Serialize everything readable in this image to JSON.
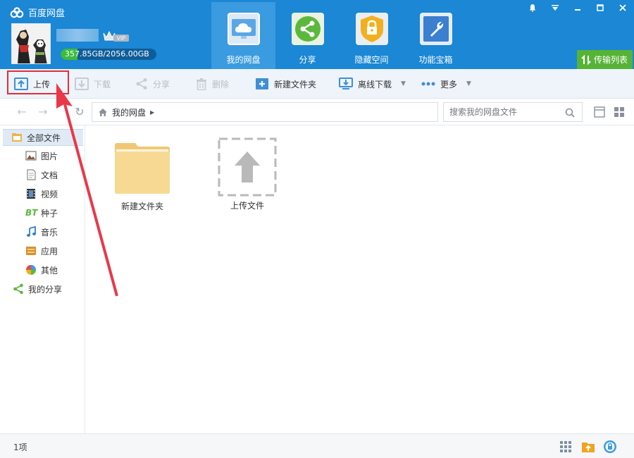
{
  "app": {
    "title": "百度网盘"
  },
  "user": {
    "quota_text": "357.85GB/2056.00GB",
    "quota_used_fraction": 0.174,
    "vip_label": "VIP"
  },
  "nav": [
    {
      "label": "我的网盘",
      "icon": "cloud-icon",
      "active": true
    },
    {
      "label": "分享",
      "icon": "share-icon"
    },
    {
      "label": "隐藏空间",
      "icon": "lock-icon"
    },
    {
      "label": "功能宝箱",
      "icon": "wrench-icon"
    }
  ],
  "transfer": {
    "label": "传输列表"
  },
  "toolbar": {
    "upload": "上传",
    "download": "下载",
    "share": "分享",
    "delete": "删除",
    "new_folder": "新建文件夹",
    "offline_download": "离线下载",
    "more": "更多"
  },
  "breadcrumb": {
    "root": "我的网盘"
  },
  "search": {
    "placeholder": "搜索我的网盘文件"
  },
  "sidebar": [
    {
      "label": "全部文件",
      "icon": "all-files-icon",
      "active": true
    },
    {
      "label": "图片",
      "icon": "image-icon"
    },
    {
      "label": "文档",
      "icon": "document-icon"
    },
    {
      "label": "视频",
      "icon": "video-icon"
    },
    {
      "label": "种子",
      "icon": "bt-icon",
      "glyph": "BT"
    },
    {
      "label": "音乐",
      "icon": "music-icon"
    },
    {
      "label": "应用",
      "icon": "app-icon"
    },
    {
      "label": "其他",
      "icon": "other-icon"
    },
    {
      "label": "我的分享",
      "icon": "my-share-icon"
    }
  ],
  "files": [
    {
      "label": "新建文件夹",
      "type": "folder"
    },
    {
      "label": "上传文件",
      "type": "upload-placeholder"
    }
  ],
  "status": {
    "count": "1项"
  },
  "colors": {
    "header": "#1b87d5",
    "nav_active": "#3b9be0",
    "transfer": "#56b336",
    "highlight": "#e52c3a",
    "quota_fill": "#3dbb3d"
  }
}
